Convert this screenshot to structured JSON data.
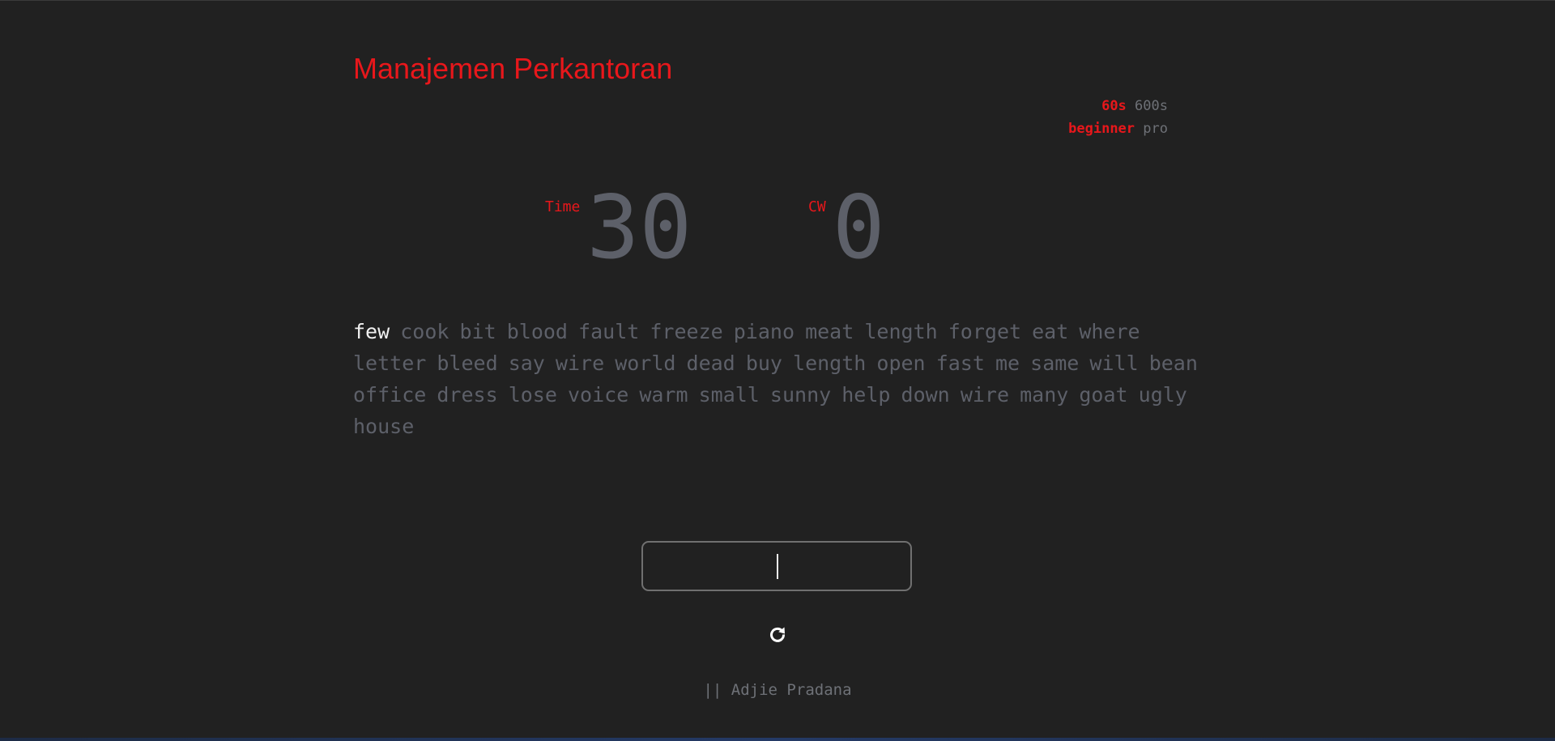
{
  "app": {
    "title": "Manajemen Perkantoran"
  },
  "options": {
    "durations": [
      {
        "label": "60s",
        "active": true
      },
      {
        "label": "600s",
        "active": false
      }
    ],
    "levels": [
      {
        "label": "beginner",
        "active": true
      },
      {
        "label": "pro",
        "active": false
      }
    ]
  },
  "stats": {
    "time_label": "Time",
    "time_value": "30",
    "cw_label": "CW",
    "cw_value": "0"
  },
  "words": {
    "current": "few",
    "rest": [
      "cook",
      "bit",
      "blood",
      "fault",
      "freeze",
      "piano",
      "meat",
      "length",
      "forget",
      "eat",
      "where",
      "letter",
      "bleed",
      "say",
      "wire",
      "world",
      "dead",
      "buy",
      "length",
      "open",
      "fast",
      "me",
      "same",
      "will",
      "bean",
      "office",
      "dress",
      "lose",
      "voice",
      "warm",
      "small",
      "sunny",
      "help",
      "down",
      "wire",
      "many",
      "goat",
      "ugly",
      "house"
    ]
  },
  "input": {
    "value": "",
    "placeholder": ""
  },
  "refresh": {
    "icon": "refresh-icon"
  },
  "footer": {
    "text": "|| Adjie Pradana"
  },
  "colors": {
    "background": "#212121",
    "accent": "#e8171b",
    "muted_text": "#5d6069",
    "active_word": "#f0f0f0"
  }
}
